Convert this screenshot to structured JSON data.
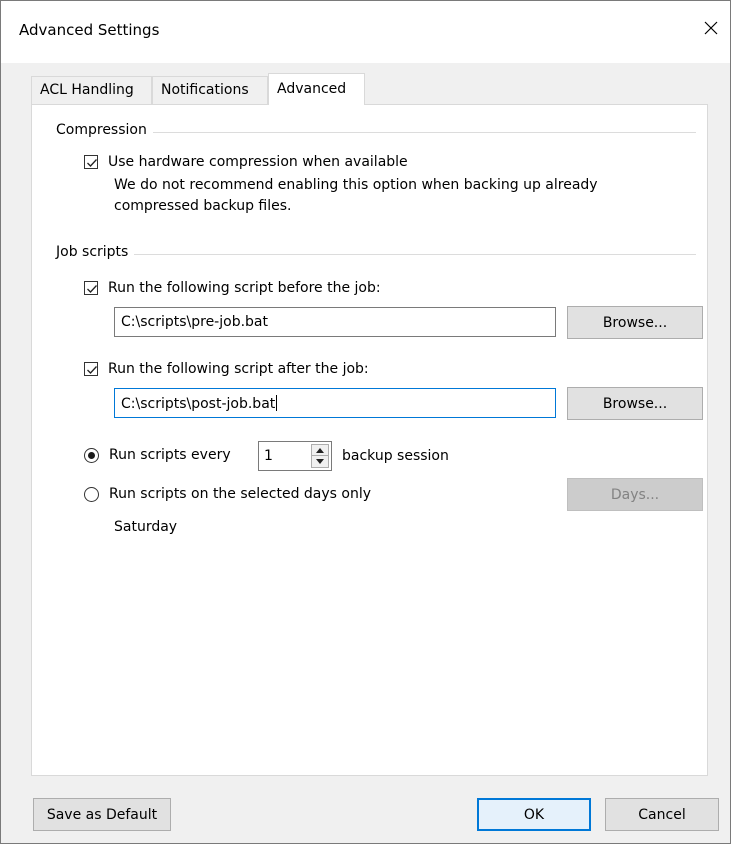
{
  "window": {
    "title": "Advanced Settings"
  },
  "tabs": [
    {
      "label": "ACL Handling"
    },
    {
      "label": "Notifications"
    },
    {
      "label": "Advanced"
    }
  ],
  "compression": {
    "group_label": "Compression",
    "hw_compression_label": "Use hardware compression when available",
    "hw_compression_checked": true,
    "note_line1": "We do not recommend enabling this option when backing up already",
    "note_line2": "compressed backup files."
  },
  "job_scripts": {
    "group_label": "Job scripts",
    "before_label": "Run the following script before the job:",
    "before_checked": true,
    "before_path": "C:\\scripts\\pre-job.bat",
    "after_label": "Run the following script after the job:",
    "after_checked": true,
    "after_path": "C:\\scripts\\post-job.bat",
    "browse_label": "Browse...",
    "every_label": "Run scripts every",
    "every_value": "1",
    "every_suffix": "backup session",
    "days_only_label": "Run scripts on the selected days only",
    "days_button": "Days...",
    "selected_days": "Saturday"
  },
  "footer": {
    "save_default": "Save as Default",
    "ok": "OK",
    "cancel": "Cancel"
  }
}
